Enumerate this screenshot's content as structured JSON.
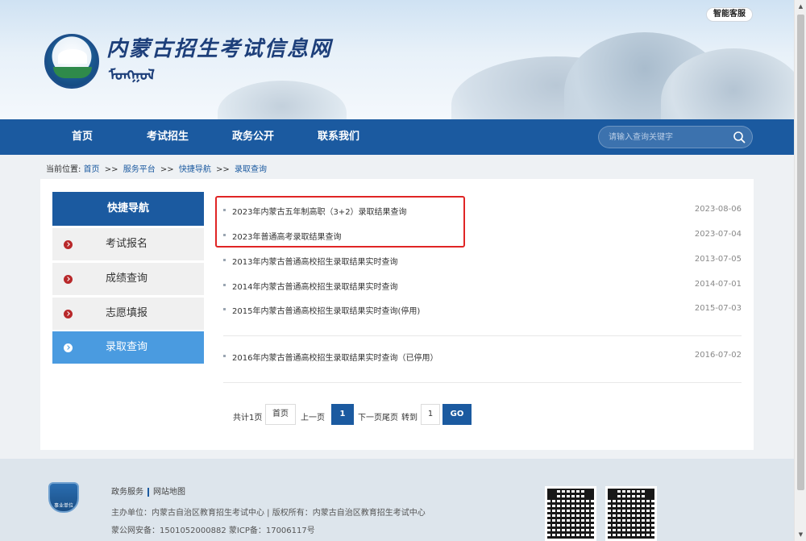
{
  "header": {
    "site_title": "内蒙古招生考试信息网",
    "mongol_script": "ᠮᠣᠩᠭᠣᠯ",
    "mode_button": "智能客服"
  },
  "nav": {
    "items": [
      "首页",
      "考试招生",
      "政务公开",
      "联系我们"
    ],
    "search_placeholder": "请输入查询关键字"
  },
  "breadcrumb": {
    "prefix": "当前位置:",
    "items": [
      "首页",
      "服务平台",
      "快捷导航",
      "录取查询"
    ],
    "separator": ">>"
  },
  "sidebar": {
    "title": "快捷导航",
    "items": [
      {
        "label": "考试报名",
        "active": false
      },
      {
        "label": "成绩查询",
        "active": false
      },
      {
        "label": "志愿填报",
        "active": false
      },
      {
        "label": "录取查询",
        "active": true
      }
    ]
  },
  "list": {
    "items": [
      {
        "title": "2023年内蒙古五年制高职（3+2）录取结果查询",
        "date": "2023-08-06"
      },
      {
        "title": "2023年普通高考录取结果查询",
        "date": "2023-07-04"
      },
      {
        "title": "2013年内蒙古普通高校招生录取结果实时查询",
        "date": "2013-07-05"
      },
      {
        "title": "2014年内蒙古普通高校招生录取结果实时查询",
        "date": "2014-07-01"
      },
      {
        "title": "2015年内蒙古普通高校招生录取结果实时查询(停用)",
        "date": "2015-07-03"
      },
      {
        "title": "2016年内蒙古普通高校招生录取结果实时查询（已停用）",
        "date": "2016-07-02"
      }
    ]
  },
  "pagination": {
    "total_text": "共计1页",
    "first": "首页",
    "prev": "上一页",
    "current": "1",
    "next_last": "下一页尾页",
    "goto_label": "转到",
    "goto_value": "1",
    "go": "GO"
  },
  "footer": {
    "logo_label": "事业单位",
    "links": [
      "政务服务",
      "网站地图"
    ],
    "host_line": "主办单位：内蒙古自治区教育招生考试中心    |    版权所有：内蒙古自治区教育招生考试中心",
    "record_line": "蒙公网安备：1501052000882    蒙ICP备：17006117号"
  },
  "colors": {
    "primary_blue": "#1b5aa0",
    "active_blue": "#4a9be0",
    "highlight_red": "#e02525",
    "bullet_red": "#b8282a"
  }
}
